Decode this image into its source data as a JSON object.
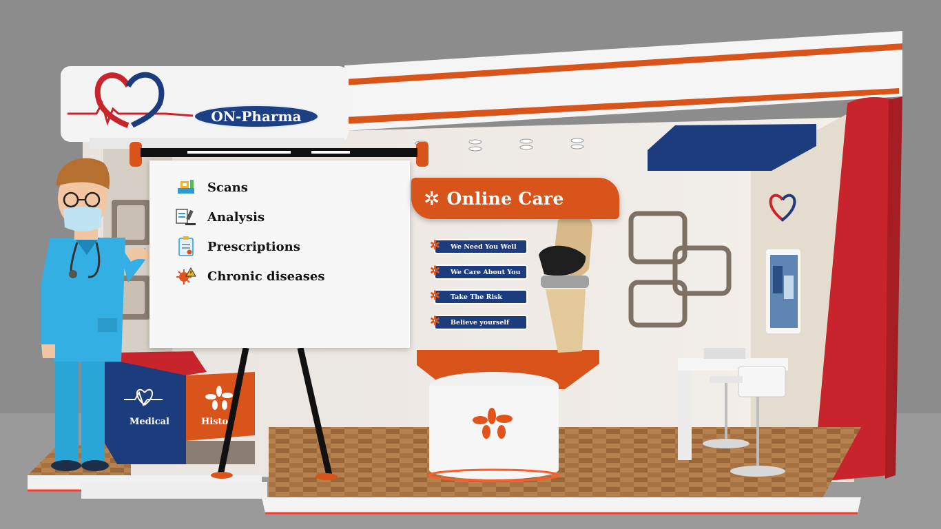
{
  "brand": {
    "name": "ON-Pharma"
  },
  "board": {
    "items": [
      {
        "label": "Scans",
        "icon": "scanner-icon"
      },
      {
        "label": "Analysis",
        "icon": "microscope-icon"
      },
      {
        "label": "Prescriptions",
        "icon": "prescription-icon"
      },
      {
        "label": "Chronic diseases",
        "icon": "virus-icon"
      }
    ]
  },
  "online_care": {
    "title": "Online Care",
    "slogans": [
      "We Need You Well",
      "We Care About You",
      "Take The Risk",
      "Believe yourself"
    ]
  },
  "reception": {
    "left_label": "Medical",
    "right_label": "Histo"
  },
  "colors": {
    "accent_orange": "#d9541a",
    "brand_blue": "#1d3c7e",
    "brand_red": "#c8242b"
  }
}
